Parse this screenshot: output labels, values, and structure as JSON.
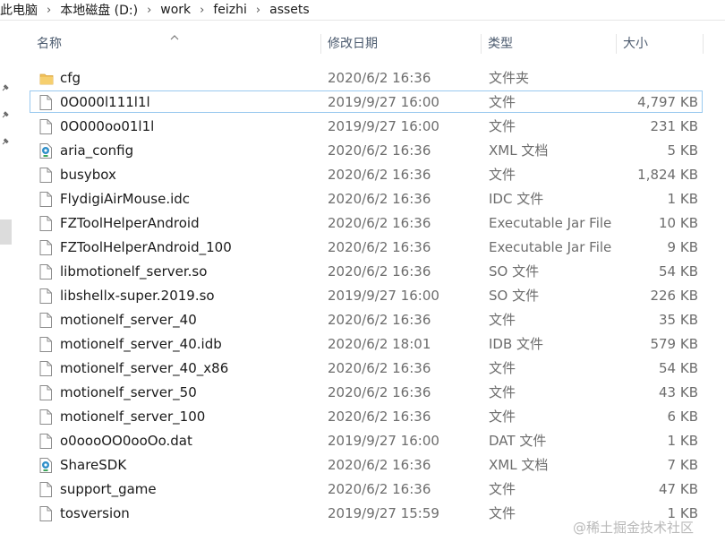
{
  "breadcrumb": {
    "items": [
      "此电脑",
      "本地磁盘 (D:)",
      "work",
      "feizhi",
      "assets"
    ]
  },
  "columns": {
    "name": "名称",
    "date": "修改日期",
    "type": "类型",
    "size": "大小",
    "sort_indicator": "sort-ascending-icon"
  },
  "files": [
    {
      "name": "cfg",
      "date": "2020/6/2 16:36",
      "type": "文件夹",
      "size": "",
      "icon": "folder-icon"
    },
    {
      "name": "0O000l111l1l",
      "date": "2019/9/27 16:00",
      "type": "文件",
      "size": "4,797 KB",
      "icon": "file-icon",
      "focused": true
    },
    {
      "name": "0O000oo01l1l",
      "date": "2019/9/27 16:00",
      "type": "文件",
      "size": "231 KB",
      "icon": "file-icon"
    },
    {
      "name": "aria_config",
      "date": "2020/6/2 16:36",
      "type": "XML 文档",
      "size": "5 KB",
      "icon": "xml-file-icon"
    },
    {
      "name": "busybox",
      "date": "2020/6/2 16:36",
      "type": "文件",
      "size": "1,824 KB",
      "icon": "file-icon"
    },
    {
      "name": "FlydigiAirMouse.idc",
      "date": "2020/6/2 16:36",
      "type": "IDC 文件",
      "size": "1 KB",
      "icon": "file-icon"
    },
    {
      "name": "FZToolHelperAndroid",
      "date": "2020/6/2 16:36",
      "type": "Executable Jar File",
      "size": "10 KB",
      "icon": "file-icon"
    },
    {
      "name": "FZToolHelperAndroid_100",
      "date": "2020/6/2 16:36",
      "type": "Executable Jar File",
      "size": "9 KB",
      "icon": "file-icon"
    },
    {
      "name": "libmotionelf_server.so",
      "date": "2020/6/2 16:36",
      "type": "SO 文件",
      "size": "54 KB",
      "icon": "file-icon"
    },
    {
      "name": "libshellx-super.2019.so",
      "date": "2019/9/27 16:00",
      "type": "SO 文件",
      "size": "226 KB",
      "icon": "file-icon"
    },
    {
      "name": "motionelf_server_40",
      "date": "2020/6/2 16:36",
      "type": "文件",
      "size": "35 KB",
      "icon": "file-icon"
    },
    {
      "name": "motionelf_server_40.idb",
      "date": "2020/6/2 18:01",
      "type": "IDB 文件",
      "size": "579 KB",
      "icon": "file-icon"
    },
    {
      "name": "motionelf_server_40_x86",
      "date": "2020/6/2 16:36",
      "type": "文件",
      "size": "54 KB",
      "icon": "file-icon"
    },
    {
      "name": "motionelf_server_50",
      "date": "2020/6/2 16:36",
      "type": "文件",
      "size": "43 KB",
      "icon": "file-icon"
    },
    {
      "name": "motionelf_server_100",
      "date": "2020/6/2 16:36",
      "type": "文件",
      "size": "6 KB",
      "icon": "file-icon"
    },
    {
      "name": "o0oooOO0ooOo.dat",
      "date": "2019/9/27 16:00",
      "type": "DAT 文件",
      "size": "1 KB",
      "icon": "file-icon"
    },
    {
      "name": "ShareSDK",
      "date": "2020/6/2 16:36",
      "type": "XML 文档",
      "size": "7 KB",
      "icon": "xml-file-icon"
    },
    {
      "name": "support_game",
      "date": "2020/6/2 16:36",
      "type": "文件",
      "size": "47 KB",
      "icon": "file-icon"
    },
    {
      "name": "tosversion",
      "date": "2019/9/27 15:59",
      "type": "文件",
      "size": "1 KB",
      "icon": "file-icon"
    }
  ],
  "watermark": "@稀土掘金技术社区",
  "colors": {
    "folder": "#f0c05a",
    "focus_border": "#99c9ef",
    "header_text": "#4b5a6e",
    "secondary_text": "#6d6d6d"
  }
}
